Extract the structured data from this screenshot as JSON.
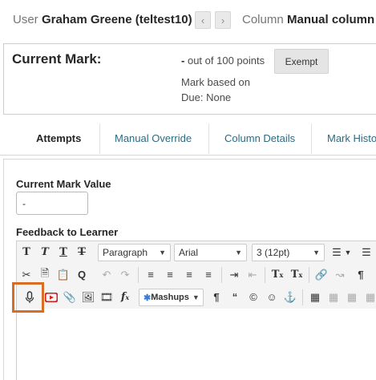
{
  "header": {
    "user_label": "User",
    "user_name": "Graham Greene (teltest10)",
    "prev_icon": "chevron-left-icon",
    "next_icon": "chevron-right-icon",
    "column_label": "Column",
    "column_name": "Manual column"
  },
  "mark": {
    "title": "Current Mark:",
    "value": "-",
    "out_of": "out of 100 points",
    "exempt_label": "Exempt",
    "based_on": "Mark based on",
    "due": "Due: None"
  },
  "tabs": [
    "Attempts",
    "Manual Override",
    "Column Details",
    "Mark History"
  ],
  "form": {
    "current_mark_label": "Current Mark Value",
    "current_mark_value": "-",
    "feedback_label": "Feedback to Learner"
  },
  "editor": {
    "paragraph": "Paragraph",
    "font": "Arial",
    "size": "3 (12pt)",
    "mashups": "Mashups",
    "row1_icons": [
      "bold-icon",
      "italic-icon",
      "underline-icon",
      "strikethrough-icon"
    ],
    "row2_icons": [
      "cut-icon",
      "copy-icon",
      "paste-icon",
      "find-icon",
      "undo-icon",
      "redo-icon",
      "align-left-icon",
      "align-center-icon",
      "align-right-icon",
      "justify-icon",
      "indent-icon",
      "outdent-icon",
      "superscript-icon",
      "clear-format-icon",
      "link-icon",
      "unlink-icon",
      "paragraph-mark-icon"
    ],
    "row3_icons": [
      "microphone-icon",
      "youtube-icon",
      "attachment-icon",
      "image-icon",
      "video-icon",
      "formula-icon",
      "pilcrow-icon",
      "quote-icon",
      "copyright-icon",
      "emoticon-icon",
      "anchor-icon",
      "table-icon"
    ]
  },
  "colors": {
    "highlight": "#d86d25",
    "link": "#2d6b81"
  }
}
